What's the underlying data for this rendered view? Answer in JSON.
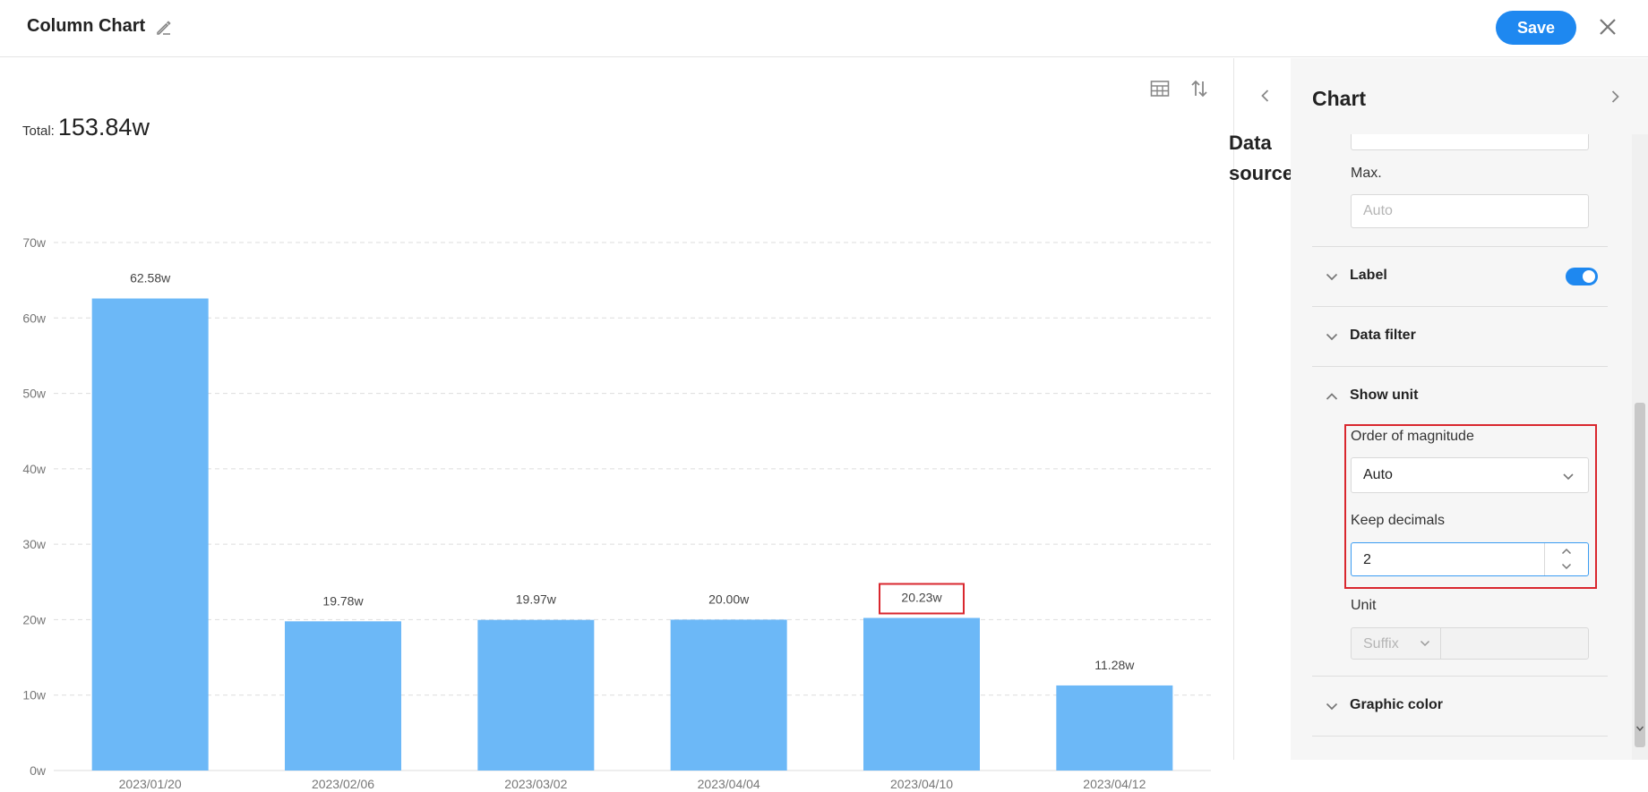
{
  "header": {
    "title": "Column Chart",
    "save_label": "Save"
  },
  "chart_panel": {
    "total_label": "Total:",
    "total_value": "153.84w"
  },
  "left_panel": {
    "data_source_label": "Data source"
  },
  "settings": {
    "title": "Chart",
    "max_label": "Max.",
    "max_placeholder": "Auto",
    "sections": {
      "label": "Label",
      "data_filter": "Data filter",
      "show_unit": "Show unit",
      "graphic_color": "Graphic color"
    },
    "label_toggle_on": true,
    "order_of_magnitude_label": "Order of magnitude",
    "order_of_magnitude_value": "Auto",
    "keep_decimals_label": "Keep decimals",
    "keep_decimals_value": "2",
    "unit_label": "Unit",
    "unit_position_value": "Suffix"
  },
  "colors": {
    "bar": "#6cb8f7",
    "accent": "#1e88f0",
    "highlight": "#d9272e"
  },
  "chart_data": {
    "type": "bar",
    "categories": [
      "2023/01/20",
      "2023/02/06",
      "2023/03/02",
      "2023/04/04",
      "2023/04/10",
      "2023/04/12"
    ],
    "values": [
      62.58,
      19.78,
      19.97,
      20.0,
      20.23,
      11.28
    ],
    "data_labels": [
      "62.58w",
      "19.78w",
      "19.97w",
      "20.00w",
      "20.23w",
      "11.28w"
    ],
    "y_ticks": [
      "0w",
      "10w",
      "20w",
      "30w",
      "40w",
      "50w",
      "60w",
      "70w"
    ],
    "ylim": [
      0,
      70
    ],
    "grid": true,
    "highlighted_category": "2023/04/10"
  }
}
